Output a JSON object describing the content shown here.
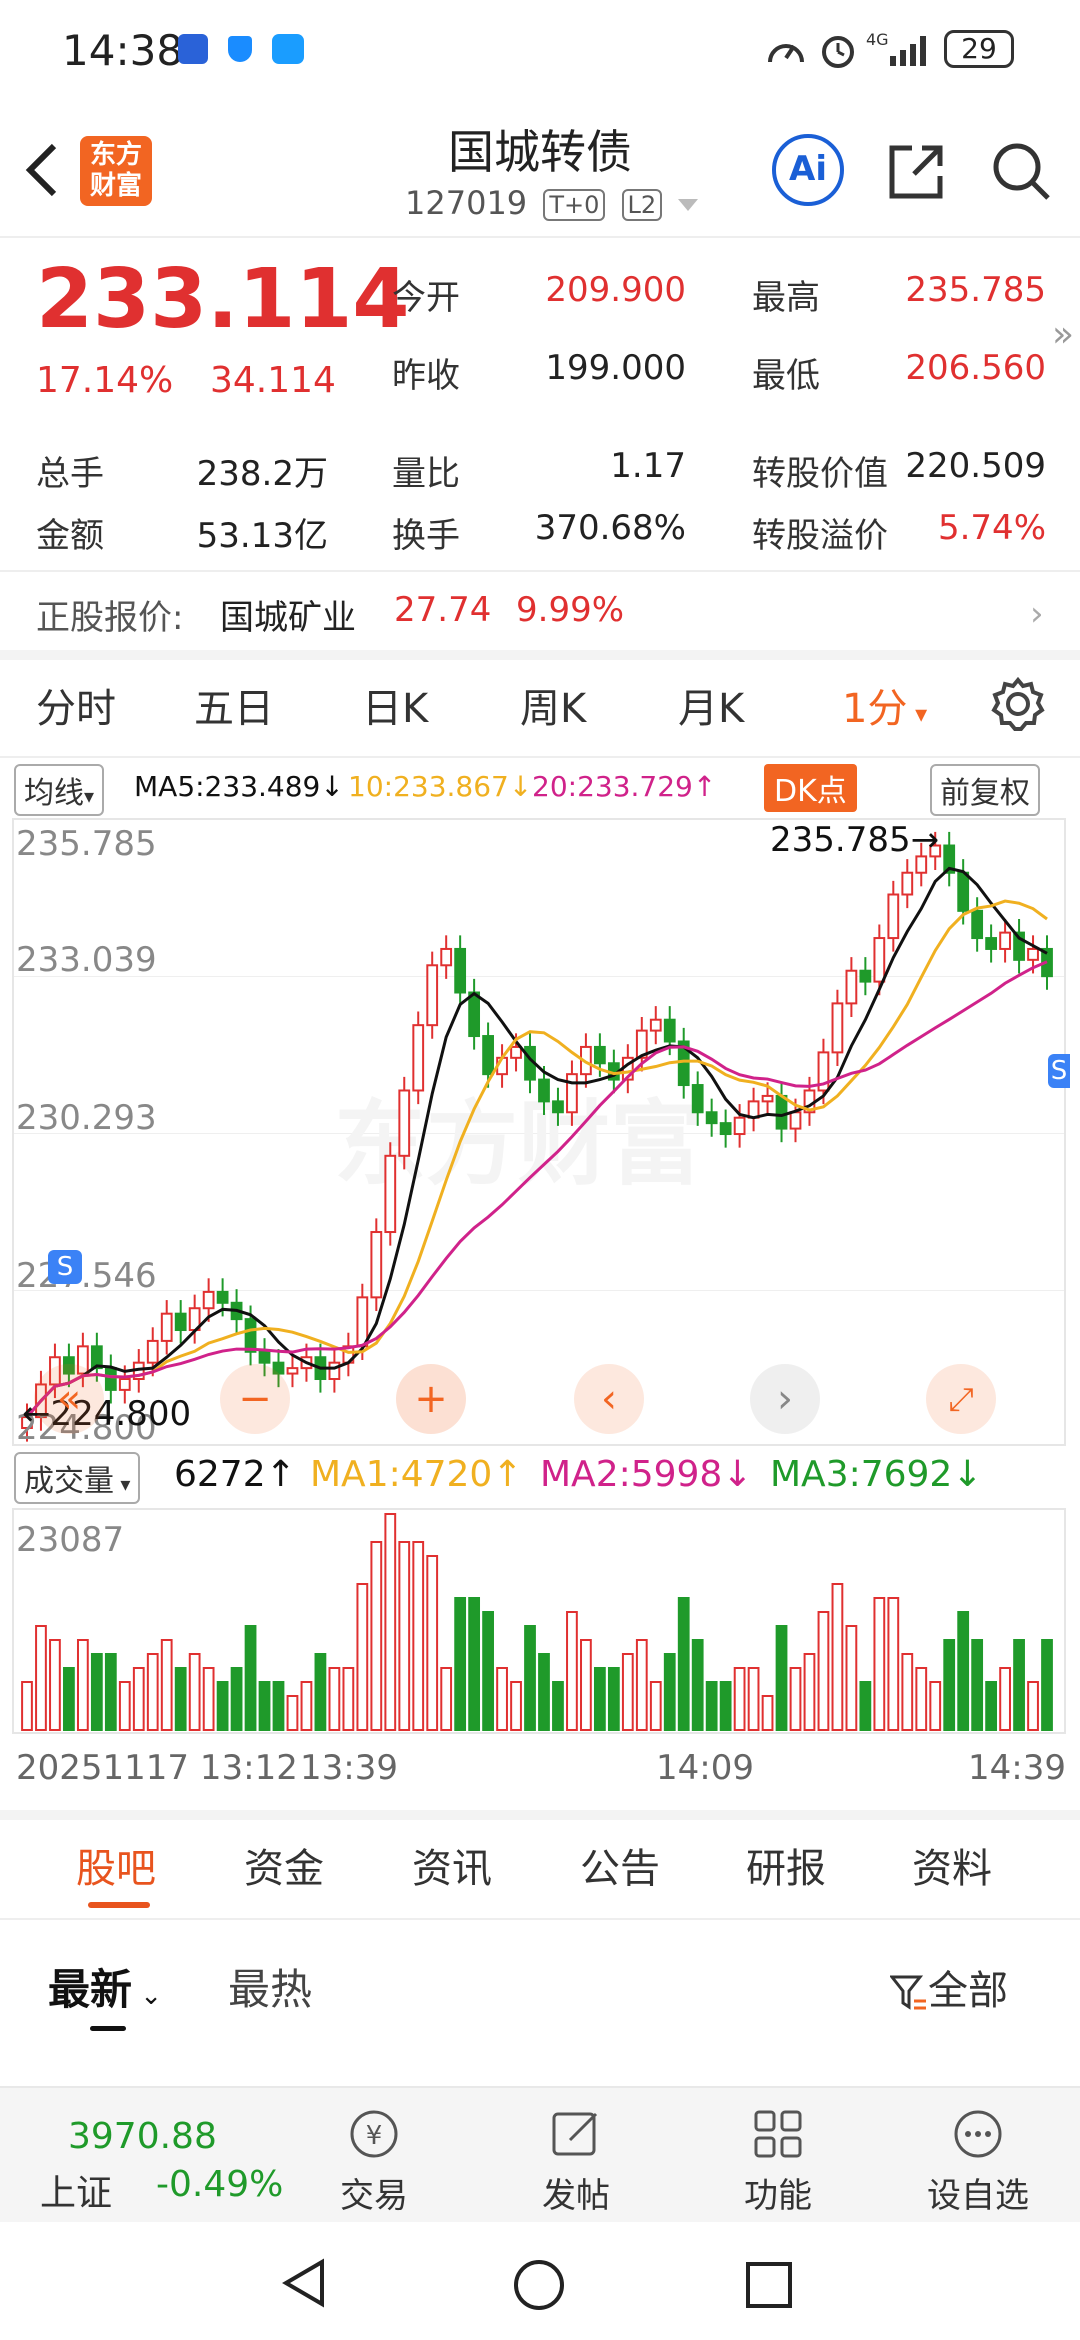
{
  "status": {
    "time": "14:38",
    "battery": "29"
  },
  "nav": {
    "title": "国城转债",
    "code": "127019",
    "tag1": "T+0",
    "tag2": "L2",
    "logo_line1": "东方",
    "logo_line2": "财富",
    "ai_label": "Ai"
  },
  "quote": {
    "price": "233.114",
    "change_pct": "17.14%",
    "change": "34.114",
    "open_label": "今开",
    "open": "209.900",
    "high_label": "最高",
    "high": "235.785",
    "prev_label": "昨收",
    "prev": "199.000",
    "low_label": "最低",
    "low": "206.560",
    "vol_label": "总手",
    "vol": "238.2万",
    "ratio_label": "量比",
    "ratio": "1.17",
    "conv_label": "转股价值",
    "conv": "220.509",
    "amount_label": "金额",
    "amount": "53.13亿",
    "turnover_label": "换手",
    "turnover": "370.68%",
    "premium_label": "转股溢价",
    "premium": "5.74%"
  },
  "stock": {
    "label": "正股报价:",
    "name": "国城矿业",
    "price": "27.74",
    "pct": "9.99%"
  },
  "period_tabs": [
    "分时",
    "五日",
    "日K",
    "周K",
    "月K",
    "1分"
  ],
  "ma_legend": {
    "type": "均线",
    "ma5": "MA5:233.489",
    "ma10": "10:233.867",
    "ma20": "20:233.729",
    "dk": "DK点",
    "adjust": "前复权"
  },
  "vol_legend": {
    "type": "成交量",
    "vol": "6272",
    "ma1": "MA1:4720",
    "ma2": "MA2:5998",
    "ma3": "MA3:7692"
  },
  "price_axis": [
    "235.785",
    "233.039",
    "230.293",
    "227.546",
    "224.800"
  ],
  "vol_axis_top": "23087",
  "markers": {
    "high": "235.785",
    "low": "224.800",
    "buy": "S",
    "sell": "S"
  },
  "time_axis": [
    "20251117 13:12",
    "13:39",
    "14:09",
    "14:39"
  ],
  "watermark": "东方财富",
  "bottom_tabs": [
    "股吧",
    "资金",
    "资讯",
    "公告",
    "研报",
    "资料"
  ],
  "sub_tabs": {
    "latest": "最新",
    "hot": "最热",
    "filter": "全部"
  },
  "footer": {
    "index_value": "3970.88",
    "index_name": "上证",
    "index_pct": "-0.49%",
    "trade": "交易",
    "post": "发帖",
    "func": "功能",
    "watch": "设自选"
  },
  "colors": {
    "up": "#e03030",
    "down": "#1f9a2a",
    "ma5": "#111111",
    "ma10": "#f0b020",
    "ma20": "#d0228a",
    "accent": "#f26522"
  },
  "chart_data": {
    "type": "candlestick",
    "x_label_ticks": [
      "20251117 13:12",
      "13:39",
      "14:09",
      "14:39"
    ],
    "ylim": [
      224.8,
      235.785
    ],
    "ohlc_close": [
      225.0,
      225.6,
      226.1,
      225.8,
      226.3,
      225.9,
      225.5,
      225.7,
      226.0,
      226.4,
      226.9,
      226.6,
      227.0,
      227.3,
      227.1,
      226.8,
      226.2,
      226.0,
      225.8,
      225.9,
      226.1,
      225.7,
      226.0,
      226.3,
      227.2,
      228.4,
      229.8,
      231.0,
      232.2,
      233.3,
      233.6,
      232.8,
      232.0,
      231.3,
      231.6,
      231.8,
      231.2,
      230.8,
      230.6,
      231.3,
      231.8,
      231.5,
      231.2,
      231.6,
      232.1,
      232.3,
      231.9,
      231.1,
      230.6,
      230.4,
      230.2,
      230.5,
      230.8,
      230.9,
      230.3,
      230.6,
      231.0,
      231.7,
      232.6,
      233.2,
      233.0,
      233.8,
      234.6,
      235.0,
      235.3,
      235.5,
      235.0,
      234.3,
      233.8,
      233.6,
      233.9,
      233.4,
      233.6,
      233.1
    ]
  }
}
